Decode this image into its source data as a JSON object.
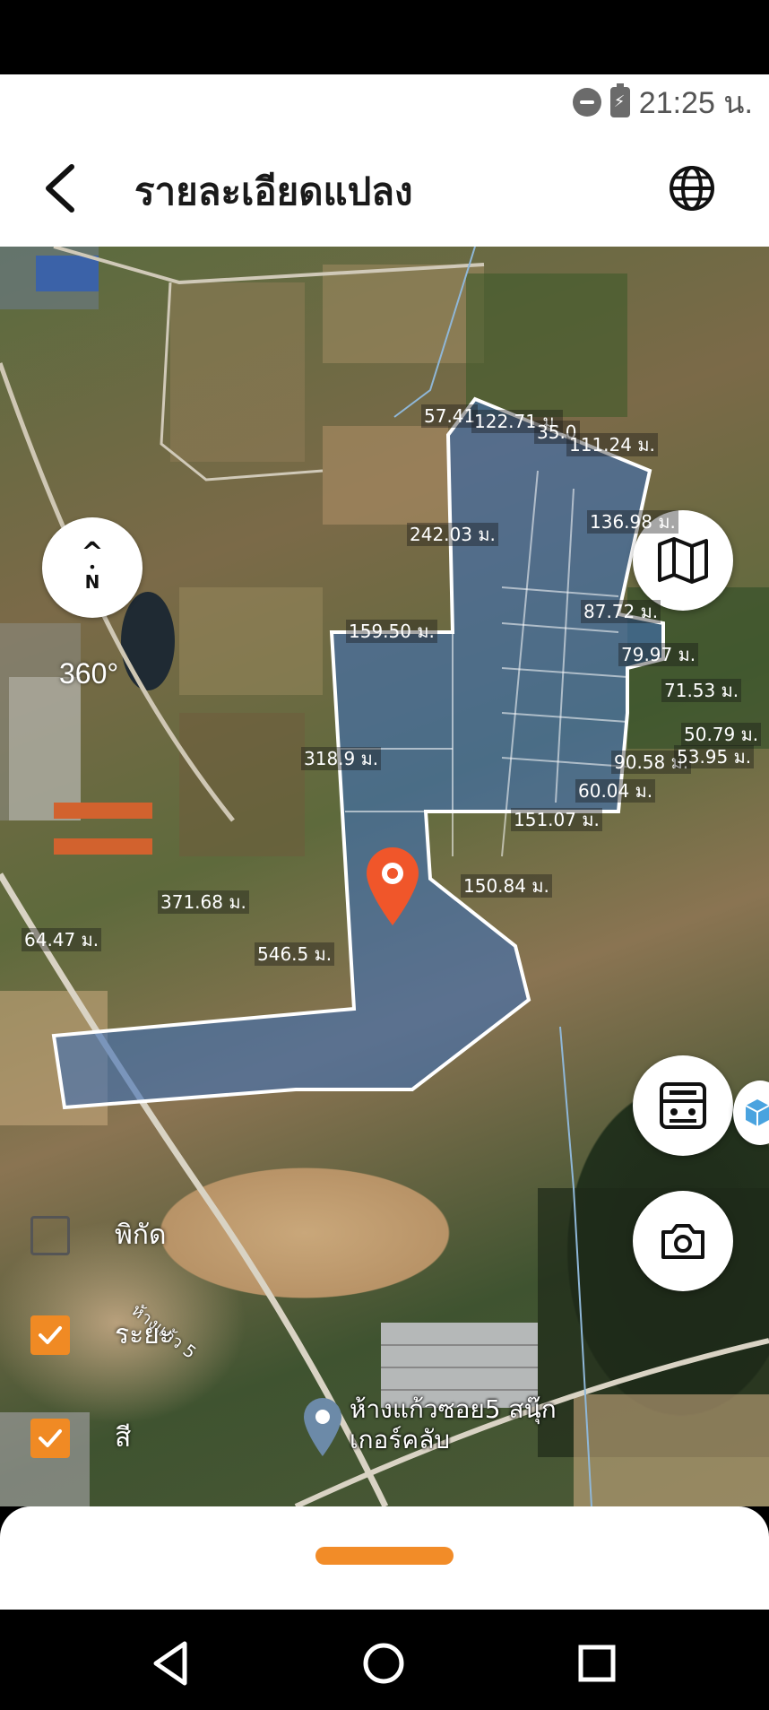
{
  "status_bar": {
    "time": "21:25 น."
  },
  "header": {
    "title": "รายละเอียดแปลง"
  },
  "map": {
    "compass_letter": "N",
    "compass_arrow": "^",
    "view_360_label": "360°",
    "distance_labels": [
      "57.41",
      "122.71 ม.",
      "35.0",
      "111.24 ม.",
      "136.98 ม.",
      "242.03 ม.",
      "87.72 ม.",
      "159.50 ม.",
      "79.97 ม.",
      "71.53 ม.",
      "50.79 ม.",
      "318.9 ม.",
      "90.58 ม.",
      "53.95 ม.",
      "60.04 ม.",
      "151.07 ม.",
      "150.84 ม.",
      "371.68 ม.",
      "64.47 ม.",
      "546.5 ม."
    ],
    "road_label": "ห้างแก้ว 5",
    "place_label": "ห้างแก้วซอย5 สนุ๊กเกอร์คลับ",
    "plot_fill_color": "#3f6fb4",
    "accent_color": "#f08a24"
  },
  "toggles": [
    {
      "label": "พิกัด",
      "checked": false
    },
    {
      "label": "ระยะ",
      "checked": true
    },
    {
      "label": "สี",
      "checked": true
    }
  ]
}
